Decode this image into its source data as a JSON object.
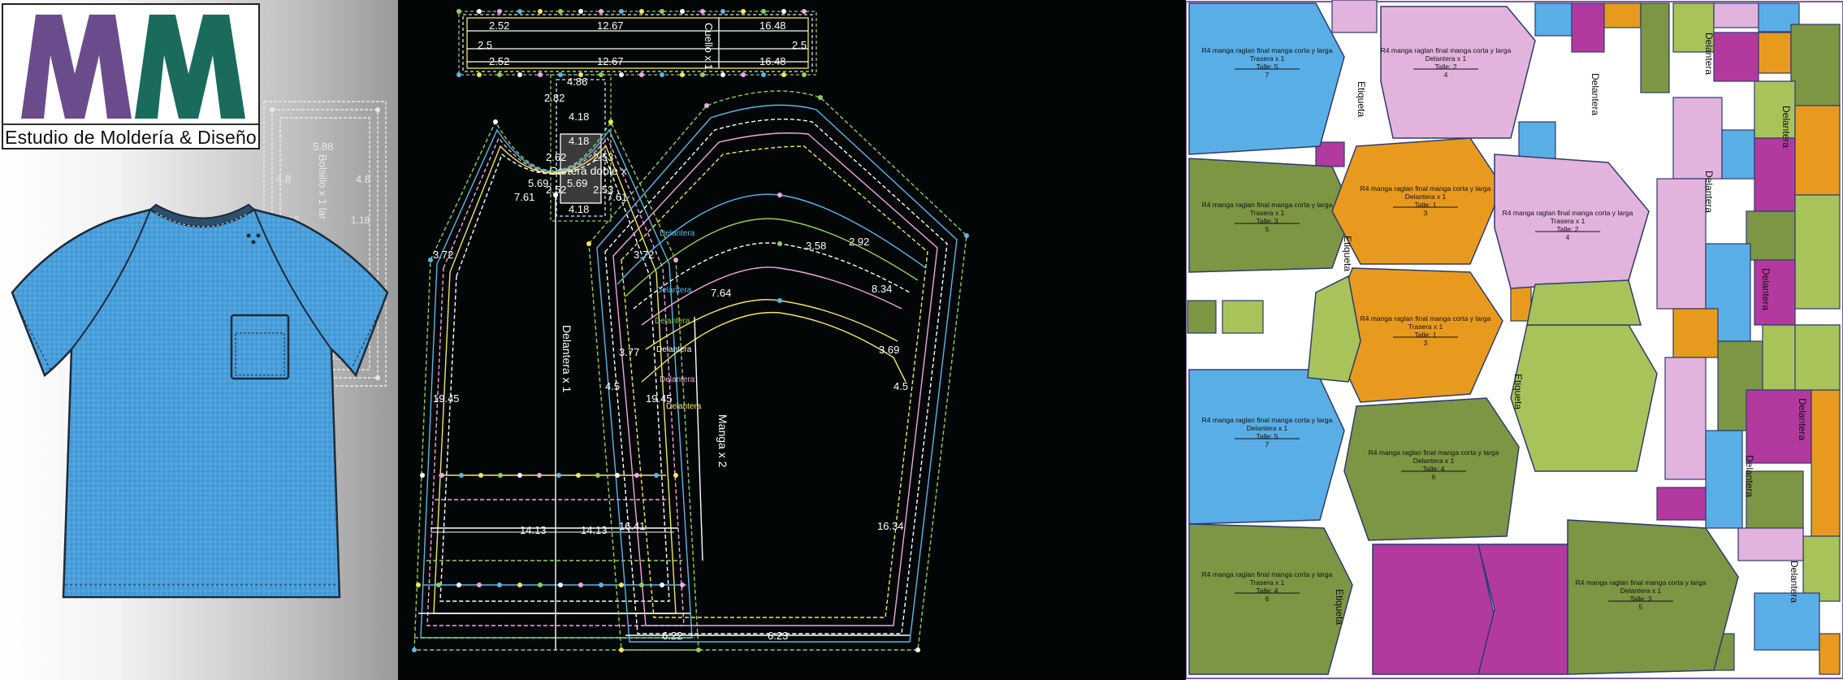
{
  "brand": {
    "logo_letters": "MM",
    "studio_name": "Estudio de Moldería & Diseño",
    "colors": {
      "m1": "#6a4c8c",
      "m2": "#1a6b5c"
    }
  },
  "colors": {
    "shirt": "#4a9fdb",
    "cad_bg": "#030606",
    "piece_blue": "#5aaee6",
    "piece_pink": "#e2b3dd",
    "piece_orange": "#e89a1e",
    "piece_olive": "#7c9644",
    "piece_green": "#a8c35a",
    "piece_magenta": "#b23a9f"
  },
  "cad": {
    "collar": {
      "name": "Cuello x 1",
      "dims": [
        "2.52",
        "12.67",
        "16.48",
        "2.5",
        "2.52",
        "12.67",
        "16.48",
        "2.5"
      ]
    },
    "placket": {
      "name": "Cartera doble x",
      "dims": [
        "4.86",
        "2.82",
        "4.18",
        "4.18",
        "2.53",
        "2.62",
        "2.53",
        "2.52",
        "4.18"
      ]
    },
    "front": {
      "name": "Delantera x 1",
      "dims": [
        "5.69",
        "5.69",
        "7.61",
        "7.61",
        "3.72",
        "3.72",
        "19.45",
        "19.45",
        "14.13",
        "14.13"
      ]
    },
    "sleeve": {
      "name": "Manga x 2",
      "dims": [
        "3.58",
        "2.92",
        "7.64",
        "8.34",
        "3.77",
        "3.69",
        "4.5",
        "4.5",
        "16.41",
        "16.34",
        "6.22",
        "6.23"
      ],
      "labels": [
        "Delantera",
        "Delantera",
        "Delantera",
        "Delantera",
        "Delantera",
        "Delantera"
      ]
    },
    "pocket_ghost": {
      "name": "Bolsillo x 1 lar",
      "dims": [
        "5.88",
        "4.8",
        "4.8",
        "1.18",
        "1.18",
        "3.12"
      ]
    }
  },
  "marker": {
    "pieces": [
      {
        "title": "R4 manga raglan final manga corta y larga",
        "part": "Trasera x 1",
        "size": "Talle: 5",
        "num": "7"
      },
      {
        "title": "R4 manga raglan final manga corta y larga",
        "part": "Delantera x 1",
        "size": "Talle: 2",
        "num": "4"
      },
      {
        "title": "R4 manga raglan final manga corta y larga",
        "part": "Trasera x 1",
        "size": "Talle: 3",
        "num": "5"
      },
      {
        "title": "R4 manga raglan final manga corta y larga",
        "part": "Delantera x 1",
        "size": "Talle: 1",
        "num": "3"
      },
      {
        "title": "R4 manga raglan final manga corta y larga",
        "part": "Trasera x 1",
        "size": "Talle: 2",
        "num": "4"
      },
      {
        "title": "R4 manga raglan final manga corta y larga",
        "part": "Trasera x 1",
        "size": "Talle: 1",
        "num": "3"
      },
      {
        "title": "R4 manga raglan final manga corta y larga",
        "part": "Delantera x 1",
        "size": "Talle: 5",
        "num": "7"
      },
      {
        "title": "R4 manga raglan final manga corta y larga",
        "part": "Delantera x 1",
        "size": "Talle: 4",
        "num": "6"
      },
      {
        "title": "R4 manga raglan final manga corta y larga",
        "part": "Trasera x 1",
        "size": "Talle: 4",
        "num": "6"
      },
      {
        "title": "R4 manga raglan final manga corta y larga",
        "part": "Delantera x 1",
        "size": "Talle: 3",
        "num": "5"
      }
    ],
    "side_labels": [
      "Etiqueta",
      "Delantera",
      "Etiqueta",
      "Delantera",
      "Etiqueta",
      "Delantera",
      "Etiqueta",
      "Delantera",
      "Delantera",
      "Delantera",
      "Delantera",
      "Delantera"
    ]
  }
}
